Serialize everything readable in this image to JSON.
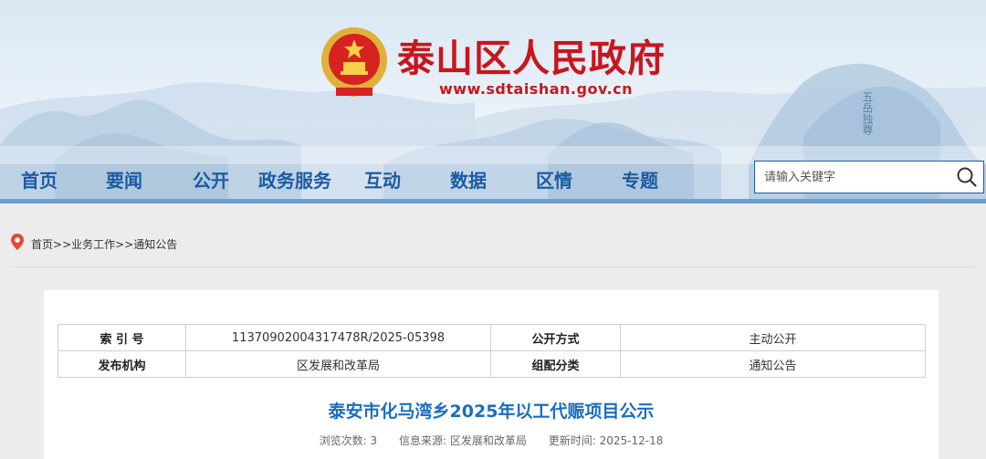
{
  "header": {
    "site_title": "泰山区人民政府",
    "site_url": "www.sdtaishan.gov.cn",
    "brand_color": "#c8161d",
    "emblem_icon": "national-emblem-icon"
  },
  "nav": {
    "items": [
      {
        "label": "首页"
      },
      {
        "label": "要闻"
      },
      {
        "label": "公开"
      },
      {
        "label": "政务服务"
      },
      {
        "label": "互动"
      },
      {
        "label": "数据"
      },
      {
        "label": "区情"
      },
      {
        "label": "专题"
      }
    ],
    "color": "#1c5ba3"
  },
  "search": {
    "placeholder": "请输入关键字",
    "icon": "search-icon"
  },
  "breadcrumb": {
    "icon": "location-pin-icon",
    "items": [
      "首页",
      "业务工作",
      "通知公告"
    ],
    "separator": ">>"
  },
  "meta_table": {
    "rows": [
      {
        "label1": "索 引 号",
        "value1": "11370902004317478R/2025-05398",
        "label2": "公开方式",
        "value2": "主动公开"
      },
      {
        "label1": "发布机构",
        "value1": "区发展和改革局",
        "label2": "组配分类",
        "value2": "通知公告"
      }
    ]
  },
  "article": {
    "title": "泰安市化马湾乡2025年以工代赈项目公示",
    "views_label": "浏览次数:",
    "views": "3",
    "source_label": "信息来源:",
    "source": "区发展和改革局",
    "updated_label": "更新时间:",
    "updated": "2025-12-18",
    "title_color": "#1a6ec1"
  }
}
